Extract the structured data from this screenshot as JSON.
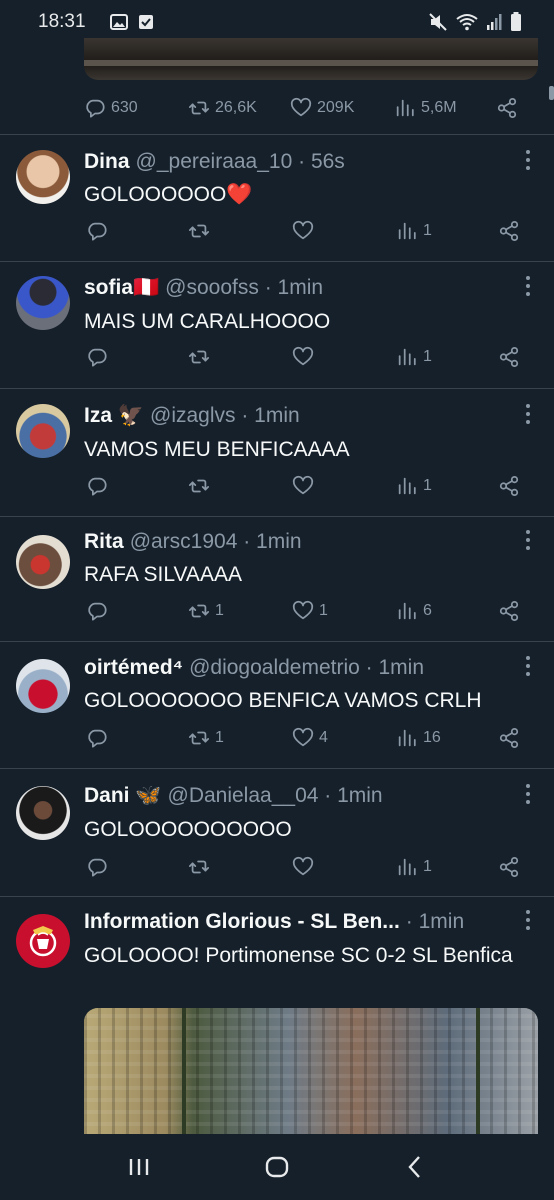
{
  "status_bar": {
    "time": "18:31"
  },
  "top_tweet": {
    "replies": "630",
    "retweets": "26,6K",
    "likes": "209K",
    "views": "5,6M"
  },
  "tweets": [
    {
      "name": "Dina",
      "handle": "@_pereiraaa_10 · 56s",
      "text": "GOLOOOOOO❤️",
      "replies": "",
      "retweets": "",
      "likes": "",
      "views": "1"
    },
    {
      "name": "sofia🇵🇪",
      "handle": "@sooofss · 1min",
      "text": "MAIS UM CARALHOOOO",
      "replies": "",
      "retweets": "",
      "likes": "",
      "views": "1"
    },
    {
      "name": "Iza 🦅",
      "handle": "@izaglvs · 1min",
      "text": "VAMOS MEU BENFICAAAA",
      "replies": "",
      "retweets": "",
      "likes": "",
      "views": "1"
    },
    {
      "name": "Rita",
      "handle": "@arsc1904 · 1min",
      "text": "RAFA SILVAAAA",
      "replies": "",
      "retweets": "1",
      "likes": "1",
      "views": "6"
    },
    {
      "name": "oirtémed⁴",
      "handle": "@diogoaldemetrio · 1min",
      "text": "GOLOOOOOOO BENFICA VAMOS CRLH",
      "replies": "",
      "retweets": "1",
      "likes": "4",
      "views": "16"
    },
    {
      "name": "Dani 🦋",
      "handle": "@Danielaa__04 · 1min",
      "text": "GOLOOOOOOOOOO",
      "replies": "",
      "retweets": "",
      "likes": "",
      "views": "1"
    },
    {
      "name": "Information Glorious - SL Ben...",
      "handle": "· 1min",
      "text": "GOLOOOO! Portimonense SC 0-2 SL Benfica"
    }
  ],
  "icons": {
    "reply": "reply-icon",
    "retweet": "retweet-icon",
    "like": "heart-icon",
    "views": "views-icon",
    "share": "share-icon"
  },
  "colors": {
    "background": "#15202b",
    "text_primary": "#f7f9f9",
    "text_secondary": "#8b98a5",
    "divider": "#38444d"
  }
}
